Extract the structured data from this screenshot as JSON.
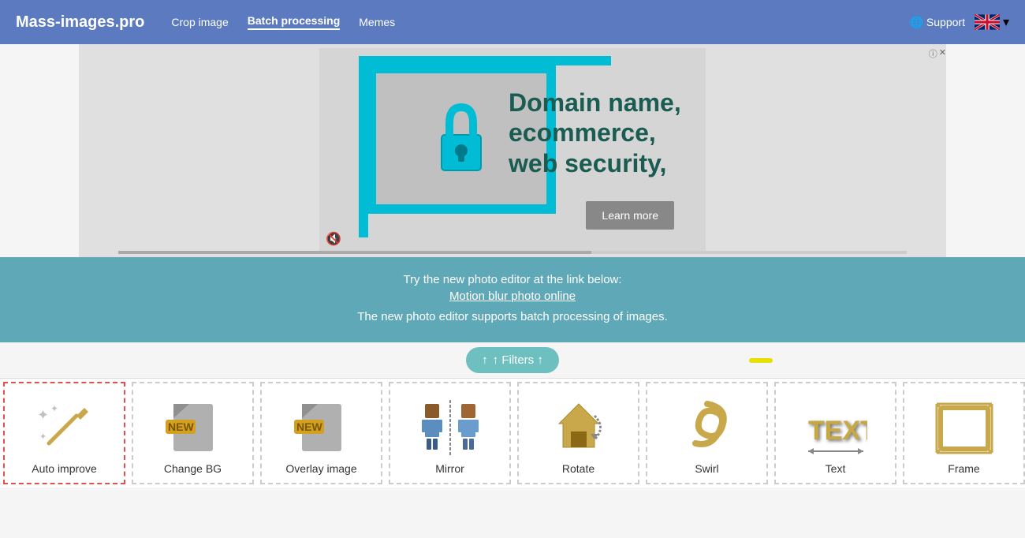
{
  "navbar": {
    "brand": "Mass-images.pro",
    "links": [
      {
        "label": "Crop image",
        "active": false
      },
      {
        "label": "Batch processing",
        "active": true
      },
      {
        "label": "Memes",
        "active": false
      }
    ],
    "support_label": "Support",
    "flag_alt": "UK Flag"
  },
  "ad": {
    "headline": "Domain name, ecommerce, web security,",
    "learn_more": "Learn more",
    "info_label": "ⓘ",
    "close_label": "✕"
  },
  "info_strip": {
    "line1": "Try the new photo editor at the link below:",
    "link_text": "Motion blur photo online",
    "line2": "The new photo editor supports batch processing of images."
  },
  "filters_button": "↑ Filters ↑",
  "tools": [
    {
      "id": "auto-improve",
      "label": "Auto improve",
      "icon_type": "wand",
      "new": false
    },
    {
      "id": "change-bg",
      "label": "Change BG",
      "icon_type": "change-bg",
      "new": true
    },
    {
      "id": "overlay-image",
      "label": "Overlay image",
      "icon_type": "overlay",
      "new": true
    },
    {
      "id": "mirror",
      "label": "Mirror",
      "icon_type": "mirror",
      "new": false
    },
    {
      "id": "rotate",
      "label": "Rotate",
      "icon_type": "rotate",
      "new": false
    },
    {
      "id": "swirl",
      "label": "Swirl",
      "icon_type": "swirl",
      "new": false
    },
    {
      "id": "text",
      "label": "Text",
      "icon_type": "text",
      "new": false
    },
    {
      "id": "frame",
      "label": "Frame",
      "icon_type": "frame",
      "new": false
    }
  ]
}
